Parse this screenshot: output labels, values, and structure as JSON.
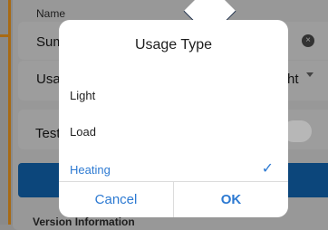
{
  "background": {
    "name_label": "Name",
    "summary_label": "Sum",
    "usage_label": "Usa",
    "light_value": "ht",
    "test_label": "Test",
    "version_label": "Version Information"
  },
  "dialog": {
    "title": "Usage Type",
    "options": [
      {
        "label": "Light",
        "selected": false
      },
      {
        "label": "Load",
        "selected": false
      },
      {
        "label": "Heating",
        "selected": true
      }
    ],
    "cancel_label": "Cancel",
    "ok_label": "OK"
  },
  "colors": {
    "accent": "#2d7ad2",
    "primary_band": "#0c467b",
    "overlay": "#8f8f8f",
    "dialog_background": "#ffffff",
    "left_accent": "#a86a14"
  },
  "icons": {
    "clear": "close-icon",
    "dropdown": "chevron-down-icon",
    "selected": "checkmark-icon"
  }
}
